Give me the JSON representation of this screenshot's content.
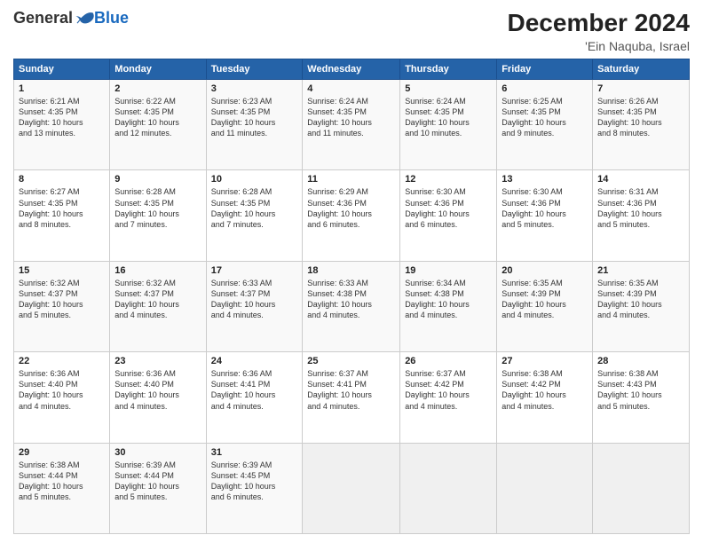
{
  "logo": {
    "general": "General",
    "blue": "Blue"
  },
  "header": {
    "month": "December 2024",
    "location": "'Ein Naquba, Israel"
  },
  "weekdays": [
    "Sunday",
    "Monday",
    "Tuesday",
    "Wednesday",
    "Thursday",
    "Friday",
    "Saturday"
  ],
  "weeks": [
    [
      {
        "day": "1",
        "info": "Sunrise: 6:21 AM\nSunset: 4:35 PM\nDaylight: 10 hours\nand 13 minutes."
      },
      {
        "day": "2",
        "info": "Sunrise: 6:22 AM\nSunset: 4:35 PM\nDaylight: 10 hours\nand 12 minutes."
      },
      {
        "day": "3",
        "info": "Sunrise: 6:23 AM\nSunset: 4:35 PM\nDaylight: 10 hours\nand 11 minutes."
      },
      {
        "day": "4",
        "info": "Sunrise: 6:24 AM\nSunset: 4:35 PM\nDaylight: 10 hours\nand 11 minutes."
      },
      {
        "day": "5",
        "info": "Sunrise: 6:24 AM\nSunset: 4:35 PM\nDaylight: 10 hours\nand 10 minutes."
      },
      {
        "day": "6",
        "info": "Sunrise: 6:25 AM\nSunset: 4:35 PM\nDaylight: 10 hours\nand 9 minutes."
      },
      {
        "day": "7",
        "info": "Sunrise: 6:26 AM\nSunset: 4:35 PM\nDaylight: 10 hours\nand 8 minutes."
      }
    ],
    [
      {
        "day": "8",
        "info": "Sunrise: 6:27 AM\nSunset: 4:35 PM\nDaylight: 10 hours\nand 8 minutes."
      },
      {
        "day": "9",
        "info": "Sunrise: 6:28 AM\nSunset: 4:35 PM\nDaylight: 10 hours\nand 7 minutes."
      },
      {
        "day": "10",
        "info": "Sunrise: 6:28 AM\nSunset: 4:35 PM\nDaylight: 10 hours\nand 7 minutes."
      },
      {
        "day": "11",
        "info": "Sunrise: 6:29 AM\nSunset: 4:36 PM\nDaylight: 10 hours\nand 6 minutes."
      },
      {
        "day": "12",
        "info": "Sunrise: 6:30 AM\nSunset: 4:36 PM\nDaylight: 10 hours\nand 6 minutes."
      },
      {
        "day": "13",
        "info": "Sunrise: 6:30 AM\nSunset: 4:36 PM\nDaylight: 10 hours\nand 5 minutes."
      },
      {
        "day": "14",
        "info": "Sunrise: 6:31 AM\nSunset: 4:36 PM\nDaylight: 10 hours\nand 5 minutes."
      }
    ],
    [
      {
        "day": "15",
        "info": "Sunrise: 6:32 AM\nSunset: 4:37 PM\nDaylight: 10 hours\nand 5 minutes."
      },
      {
        "day": "16",
        "info": "Sunrise: 6:32 AM\nSunset: 4:37 PM\nDaylight: 10 hours\nand 4 minutes."
      },
      {
        "day": "17",
        "info": "Sunrise: 6:33 AM\nSunset: 4:37 PM\nDaylight: 10 hours\nand 4 minutes."
      },
      {
        "day": "18",
        "info": "Sunrise: 6:33 AM\nSunset: 4:38 PM\nDaylight: 10 hours\nand 4 minutes."
      },
      {
        "day": "19",
        "info": "Sunrise: 6:34 AM\nSunset: 4:38 PM\nDaylight: 10 hours\nand 4 minutes."
      },
      {
        "day": "20",
        "info": "Sunrise: 6:35 AM\nSunset: 4:39 PM\nDaylight: 10 hours\nand 4 minutes."
      },
      {
        "day": "21",
        "info": "Sunrise: 6:35 AM\nSunset: 4:39 PM\nDaylight: 10 hours\nand 4 minutes."
      }
    ],
    [
      {
        "day": "22",
        "info": "Sunrise: 6:36 AM\nSunset: 4:40 PM\nDaylight: 10 hours\nand 4 minutes."
      },
      {
        "day": "23",
        "info": "Sunrise: 6:36 AM\nSunset: 4:40 PM\nDaylight: 10 hours\nand 4 minutes."
      },
      {
        "day": "24",
        "info": "Sunrise: 6:36 AM\nSunset: 4:41 PM\nDaylight: 10 hours\nand 4 minutes."
      },
      {
        "day": "25",
        "info": "Sunrise: 6:37 AM\nSunset: 4:41 PM\nDaylight: 10 hours\nand 4 minutes."
      },
      {
        "day": "26",
        "info": "Sunrise: 6:37 AM\nSunset: 4:42 PM\nDaylight: 10 hours\nand 4 minutes."
      },
      {
        "day": "27",
        "info": "Sunrise: 6:38 AM\nSunset: 4:42 PM\nDaylight: 10 hours\nand 4 minutes."
      },
      {
        "day": "28",
        "info": "Sunrise: 6:38 AM\nSunset: 4:43 PM\nDaylight: 10 hours\nand 5 minutes."
      }
    ],
    [
      {
        "day": "29",
        "info": "Sunrise: 6:38 AM\nSunset: 4:44 PM\nDaylight: 10 hours\nand 5 minutes."
      },
      {
        "day": "30",
        "info": "Sunrise: 6:39 AM\nSunset: 4:44 PM\nDaylight: 10 hours\nand 5 minutes."
      },
      {
        "day": "31",
        "info": "Sunrise: 6:39 AM\nSunset: 4:45 PM\nDaylight: 10 hours\nand 6 minutes."
      },
      {
        "day": "",
        "info": ""
      },
      {
        "day": "",
        "info": ""
      },
      {
        "day": "",
        "info": ""
      },
      {
        "day": "",
        "info": ""
      }
    ]
  ]
}
